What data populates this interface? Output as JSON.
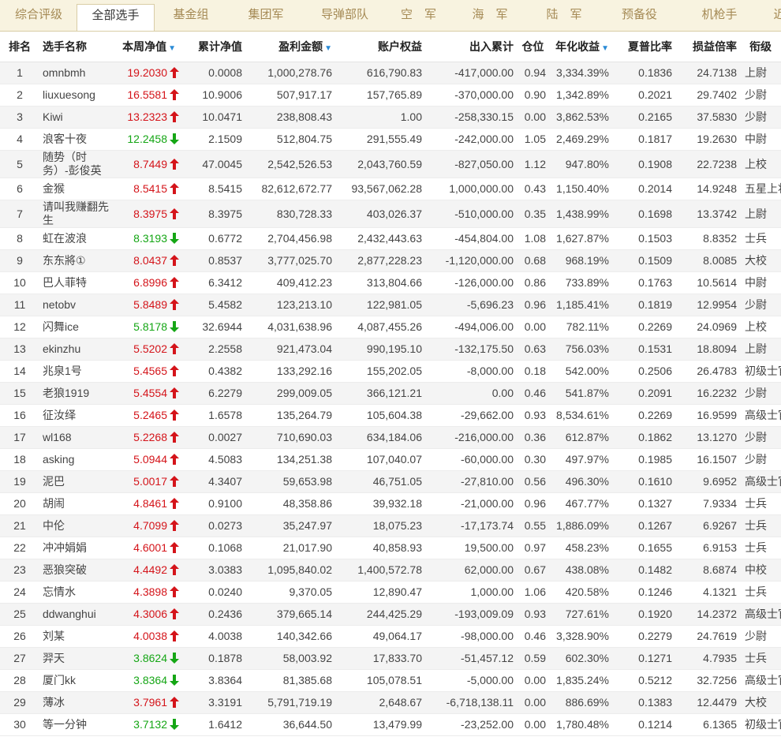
{
  "tabs": [
    "综合评级",
    "全部选手",
    "基金组",
    "集团军",
    "导弹部队",
    "空　军",
    "海　军",
    "陆　军",
    "预备役",
    "机枪手",
    "近"
  ],
  "active_tab": 1,
  "columns": [
    "排名",
    "选手名称",
    "本周净值",
    "累计净值",
    "盈利金额",
    "账户权益",
    "出入累计",
    "仓位",
    "年化收益",
    "夏普比率",
    "损益倍率",
    "衔级"
  ],
  "sort_indicator": "▼",
  "colors": {
    "up": "#d4141a",
    "down": "#15a615",
    "tab_bg": "#f8f3e0",
    "tab_text": "#a58a55",
    "sort": "#2a8bd6"
  },
  "rows": [
    {
      "rank": "1",
      "name": "omnbmh",
      "nv": "19.2030",
      "dir": "up",
      "cum": "0.0008",
      "profit": "1,000,278.76",
      "equity": "616,790.83",
      "flow": "-417,000.00",
      "pos": "0.94",
      "annual": "3,334.39%",
      "sharpe": "0.1836",
      "pl": "24.7138",
      "grade": "上尉"
    },
    {
      "rank": "2",
      "name": "liuxuesong",
      "nv": "16.5581",
      "dir": "up",
      "cum": "10.9006",
      "profit": "507,917.17",
      "equity": "157,765.89",
      "flow": "-370,000.00",
      "pos": "0.90",
      "annual": "1,342.89%",
      "sharpe": "0.2021",
      "pl": "29.7402",
      "grade": "少尉"
    },
    {
      "rank": "3",
      "name": "Kiwi",
      "nv": "13.2323",
      "dir": "up",
      "cum": "10.0471",
      "profit": "238,808.43",
      "equity": "1.00",
      "flow": "-258,330.15",
      "pos": "0.00",
      "annual": "3,862.53%",
      "sharpe": "0.2165",
      "pl": "37.5830",
      "grade": "少尉"
    },
    {
      "rank": "4",
      "name": "浪客十夜",
      "nv": "12.2458",
      "dir": "down",
      "cum": "2.1509",
      "profit": "512,804.75",
      "equity": "291,555.49",
      "flow": "-242,000.00",
      "pos": "1.05",
      "annual": "2,469.29%",
      "sharpe": "0.1817",
      "pl": "19.2630",
      "grade": "中尉"
    },
    {
      "rank": "5",
      "name": "随势（时务）-彭俊英",
      "nv": "8.7449",
      "dir": "up",
      "cum": "47.0045",
      "profit": "2,542,526.53",
      "equity": "2,043,760.59",
      "flow": "-827,050.00",
      "pos": "1.12",
      "annual": "947.80%",
      "sharpe": "0.1908",
      "pl": "22.7238",
      "grade": "上校",
      "tall": true
    },
    {
      "rank": "6",
      "name": "金猴",
      "nv": "8.5415",
      "dir": "up",
      "cum": "8.5415",
      "profit": "82,612,672.77",
      "equity": "93,567,062.28",
      "flow": "1,000,000.00",
      "pos": "0.43",
      "annual": "1,150.40%",
      "sharpe": "0.2014",
      "pl": "14.9248",
      "grade": "五星上将"
    },
    {
      "rank": "7",
      "name": "请叫我赚翻先生",
      "nv": "8.3975",
      "dir": "up",
      "cum": "8.3975",
      "profit": "830,728.33",
      "equity": "403,026.37",
      "flow": "-510,000.00",
      "pos": "0.35",
      "annual": "1,438.99%",
      "sharpe": "0.1698",
      "pl": "13.3742",
      "grade": "上尉",
      "tall": true
    },
    {
      "rank": "8",
      "name": "虹在波浪",
      "nv": "8.3193",
      "dir": "down",
      "cum": "0.6772",
      "profit": "2,704,456.98",
      "equity": "2,432,443.63",
      "flow": "-454,804.00",
      "pos": "1.08",
      "annual": "1,627.87%",
      "sharpe": "0.1503",
      "pl": "8.8352",
      "grade": "士兵"
    },
    {
      "rank": "9",
      "name": "东东將①",
      "nv": "8.0437",
      "dir": "up",
      "cum": "0.8537",
      "profit": "3,777,025.70",
      "equity": "2,877,228.23",
      "flow": "-1,120,000.00",
      "pos": "0.68",
      "annual": "968.19%",
      "sharpe": "0.1509",
      "pl": "8.0085",
      "grade": "大校"
    },
    {
      "rank": "10",
      "name": "巴人菲特",
      "nv": "6.8996",
      "dir": "up",
      "cum": "6.3412",
      "profit": "409,412.23",
      "equity": "313,804.66",
      "flow": "-126,000.00",
      "pos": "0.86",
      "annual": "733.89%",
      "sharpe": "0.1763",
      "pl": "10.5614",
      "grade": "中尉"
    },
    {
      "rank": "11",
      "name": "netobv",
      "nv": "5.8489",
      "dir": "up",
      "cum": "5.4582",
      "profit": "123,213.10",
      "equity": "122,981.05",
      "flow": "-5,696.23",
      "pos": "0.96",
      "annual": "1,185.41%",
      "sharpe": "0.1819",
      "pl": "12.9954",
      "grade": "少尉"
    },
    {
      "rank": "12",
      "name": "闪舞ice",
      "nv": "5.8178",
      "dir": "down",
      "cum": "32.6944",
      "profit": "4,031,638.96",
      "equity": "4,087,455.26",
      "flow": "-494,006.00",
      "pos": "0.00",
      "annual": "782.11%",
      "sharpe": "0.2269",
      "pl": "24.0969",
      "grade": "上校"
    },
    {
      "rank": "13",
      "name": "ekinzhu",
      "nv": "5.5202",
      "dir": "up",
      "cum": "2.2558",
      "profit": "921,473.04",
      "equity": "990,195.10",
      "flow": "-132,175.50",
      "pos": "0.63",
      "annual": "756.03%",
      "sharpe": "0.1531",
      "pl": "18.8094",
      "grade": "上尉"
    },
    {
      "rank": "14",
      "name": "兆泉1号",
      "nv": "5.4565",
      "dir": "up",
      "cum": "0.4382",
      "profit": "133,292.16",
      "equity": "155,202.05",
      "flow": "-8,000.00",
      "pos": "0.18",
      "annual": "542.00%",
      "sharpe": "0.2506",
      "pl": "26.4783",
      "grade": "初级士官"
    },
    {
      "rank": "15",
      "name": "老狼1919",
      "nv": "5.4554",
      "dir": "up",
      "cum": "6.2279",
      "profit": "299,009.05",
      "equity": "366,121.21",
      "flow": "0.00",
      "pos": "0.46",
      "annual": "541.87%",
      "sharpe": "0.2091",
      "pl": "16.2232",
      "grade": "少尉"
    },
    {
      "rank": "16",
      "name": "征汝绎",
      "nv": "5.2465",
      "dir": "up",
      "cum": "1.6578",
      "profit": "135,264.79",
      "equity": "105,604.38",
      "flow": "-29,662.00",
      "pos": "0.93",
      "annual": "8,534.61%",
      "sharpe": "0.2269",
      "pl": "16.9599",
      "grade": "高级士官"
    },
    {
      "rank": "17",
      "name": "wl168",
      "nv": "5.2268",
      "dir": "up",
      "cum": "0.0027",
      "profit": "710,690.03",
      "equity": "634,184.06",
      "flow": "-216,000.00",
      "pos": "0.36",
      "annual": "612.87%",
      "sharpe": "0.1862",
      "pl": "13.1270",
      "grade": "少尉"
    },
    {
      "rank": "18",
      "name": "asking",
      "nv": "5.0944",
      "dir": "up",
      "cum": "4.5083",
      "profit": "134,251.38",
      "equity": "107,040.07",
      "flow": "-60,000.00",
      "pos": "0.30",
      "annual": "497.97%",
      "sharpe": "0.1985",
      "pl": "16.1507",
      "grade": "少尉"
    },
    {
      "rank": "19",
      "name": "泥巴",
      "nv": "5.0017",
      "dir": "up",
      "cum": "4.3407",
      "profit": "59,653.98",
      "equity": "46,751.05",
      "flow": "-27,810.00",
      "pos": "0.56",
      "annual": "496.30%",
      "sharpe": "0.1610",
      "pl": "9.6952",
      "grade": "高级士官"
    },
    {
      "rank": "20",
      "name": "胡闹",
      "nv": "4.8461",
      "dir": "up",
      "cum": "0.9100",
      "profit": "48,358.86",
      "equity": "39,932.18",
      "flow": "-21,000.00",
      "pos": "0.96",
      "annual": "467.77%",
      "sharpe": "0.1327",
      "pl": "7.9334",
      "grade": "士兵"
    },
    {
      "rank": "21",
      "name": "中伦",
      "nv": "4.7099",
      "dir": "up",
      "cum": "0.0273",
      "profit": "35,247.97",
      "equity": "18,075.23",
      "flow": "-17,173.74",
      "pos": "0.55",
      "annual": "1,886.09%",
      "sharpe": "0.1267",
      "pl": "6.9267",
      "grade": "士兵"
    },
    {
      "rank": "22",
      "name": "冲冲娟娟",
      "nv": "4.6001",
      "dir": "up",
      "cum": "0.1068",
      "profit": "21,017.90",
      "equity": "40,858.93",
      "flow": "19,500.00",
      "pos": "0.97",
      "annual": "458.23%",
      "sharpe": "0.1655",
      "pl": "6.9153",
      "grade": "士兵"
    },
    {
      "rank": "23",
      "name": "恶狼突破",
      "nv": "4.4492",
      "dir": "up",
      "cum": "3.0383",
      "profit": "1,095,840.02",
      "equity": "1,400,572.78",
      "flow": "62,000.00",
      "pos": "0.67",
      "annual": "438.08%",
      "sharpe": "0.1482",
      "pl": "8.6874",
      "grade": "中校"
    },
    {
      "rank": "24",
      "name": "忘情水",
      "nv": "4.3898",
      "dir": "up",
      "cum": "0.0240",
      "profit": "9,370.05",
      "equity": "12,890.47",
      "flow": "1,000.00",
      "pos": "1.06",
      "annual": "420.58%",
      "sharpe": "0.1246",
      "pl": "4.1321",
      "grade": "士兵"
    },
    {
      "rank": "25",
      "name": "ddwanghui",
      "nv": "4.3006",
      "dir": "up",
      "cum": "0.2436",
      "profit": "379,665.14",
      "equity": "244,425.29",
      "flow": "-193,009.09",
      "pos": "0.93",
      "annual": "727.61%",
      "sharpe": "0.1920",
      "pl": "14.2372",
      "grade": "高级士官"
    },
    {
      "rank": "26",
      "name": "刘某",
      "nv": "4.0038",
      "dir": "up",
      "cum": "4.0038",
      "profit": "140,342.66",
      "equity": "49,064.17",
      "flow": "-98,000.00",
      "pos": "0.46",
      "annual": "3,328.90%",
      "sharpe": "0.2279",
      "pl": "24.7619",
      "grade": "少尉"
    },
    {
      "rank": "27",
      "name": "羿天",
      "nv": "3.8624",
      "dir": "down",
      "cum": "0.1878",
      "profit": "58,003.92",
      "equity": "17,833.70",
      "flow": "-51,457.12",
      "pos": "0.59",
      "annual": "602.30%",
      "sharpe": "0.1271",
      "pl": "4.7935",
      "grade": "士兵"
    },
    {
      "rank": "28",
      "name": "厦门kk",
      "nv": "3.8364",
      "dir": "down",
      "cum": "3.8364",
      "profit": "81,385.68",
      "equity": "105,078.51",
      "flow": "-5,000.00",
      "pos": "0.00",
      "annual": "1,835.24%",
      "sharpe": "0.5212",
      "pl": "32.7256",
      "grade": "高级士官"
    },
    {
      "rank": "29",
      "name": "薄冰",
      "nv": "3.7961",
      "dir": "up",
      "cum": "3.3191",
      "profit": "5,791,719.19",
      "equity": "2,648.67",
      "flow": "-6,718,138.11",
      "pos": "0.00",
      "annual": "886.69%",
      "sharpe": "0.1383",
      "pl": "12.4479",
      "grade": "大校"
    },
    {
      "rank": "30",
      "name": "等一分钟",
      "nv": "3.7132",
      "dir": "down",
      "cum": "1.6412",
      "profit": "36,644.50",
      "equity": "13,479.99",
      "flow": "-23,252.00",
      "pos": "0.00",
      "annual": "1,780.48%",
      "sharpe": "0.1214",
      "pl": "6.1365",
      "grade": "初级士官"
    }
  ]
}
